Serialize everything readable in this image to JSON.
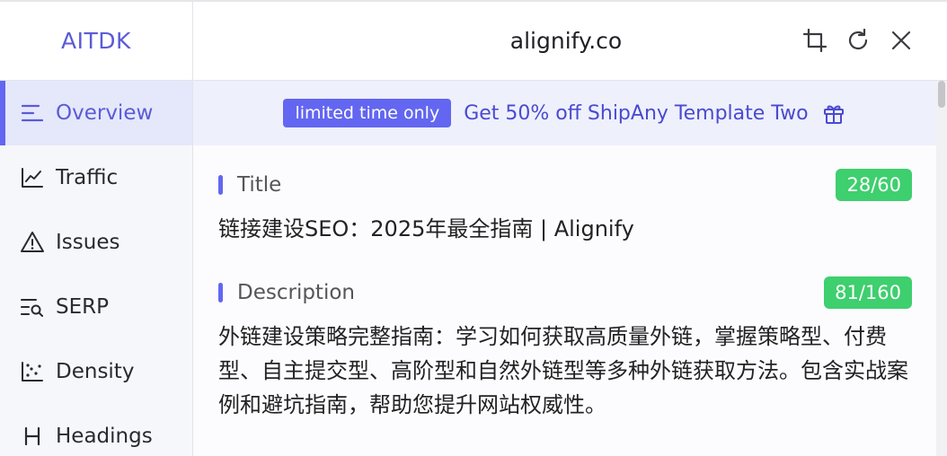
{
  "brand": "AITDK",
  "header": {
    "domain": "alignify.co"
  },
  "sidebar": {
    "items": [
      {
        "label": "Overview",
        "icon": "menu-lines-icon",
        "active": true
      },
      {
        "label": "Traffic",
        "icon": "line-chart-icon",
        "active": false
      },
      {
        "label": "Issues",
        "icon": "warning-icon",
        "active": false
      },
      {
        "label": "SERP",
        "icon": "serp-search-icon",
        "active": false
      },
      {
        "label": "Density",
        "icon": "scatter-icon",
        "active": false
      },
      {
        "label": "Headings",
        "icon": "heading-icon",
        "active": false
      }
    ]
  },
  "promo": {
    "badge": "limited time only",
    "text": "Get 50% off ShipAny Template Two",
    "icon": "gift-icon"
  },
  "title_section": {
    "label": "Title",
    "count": "28/60",
    "value": "链接建设SEO：2025年最全指南 | Alignify"
  },
  "description_section": {
    "label": "Description",
    "count": "81/160",
    "value": "外链建设策略完整指南：学习如何获取高质量外链，掌握策略型、付费型、自主提交型、高阶型和自然外链型等多种外链获取方法。包含实战案例和避坑指南，帮助您提升网站权威性。"
  },
  "colors": {
    "accent": "#6366f1",
    "brand": "#5b5bd6",
    "count_badge": "#3ecf6e",
    "promo_bg": "#eef0fc"
  }
}
